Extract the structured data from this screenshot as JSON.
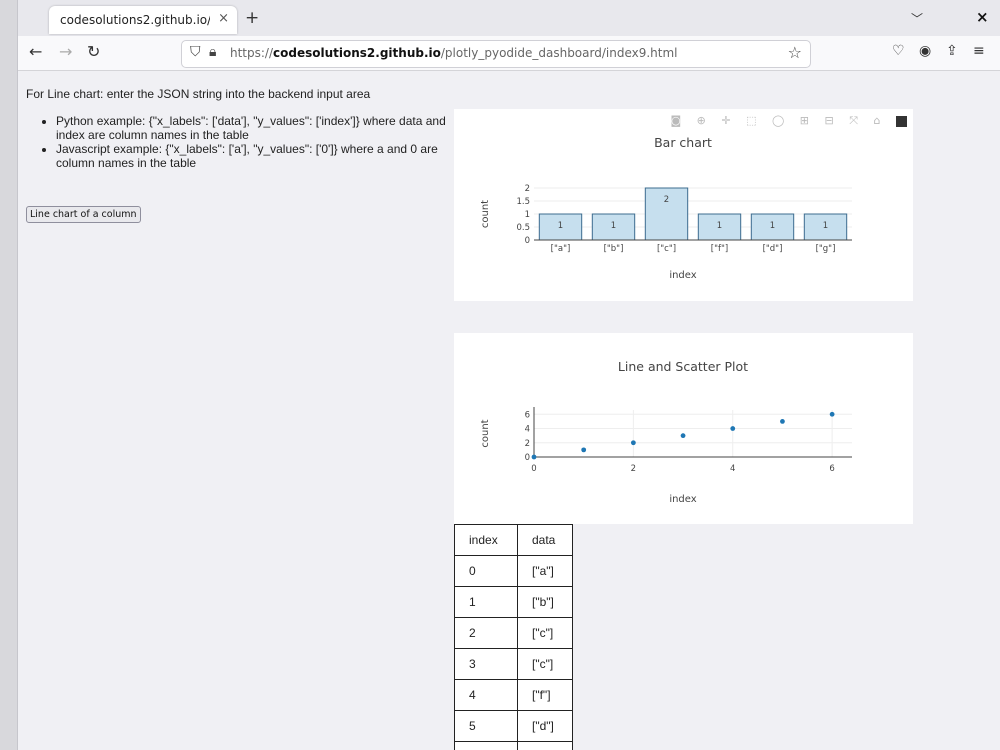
{
  "browser": {
    "tab_title": "codesolutions2.github.io/plo",
    "url_prefix": "https://",
    "url_domain": "codesolutions2.github.io",
    "url_path": "/plotly_pyodide_dashboard/index9.html"
  },
  "page": {
    "intro": "For Line chart: enter the JSON string into the backend input area",
    "bullets": [
      "Python example: {\"x_labels\": ['data'], \"y_values\": ['index']} where data and index are column names in the table",
      "Javascript example: {\"x_labels\": ['a'], \"y_values\": ['0']} where a and 0 are column names in the table"
    ],
    "line_button": "Line chart of a column"
  },
  "chart_data": [
    {
      "type": "bar",
      "title": "Bar chart",
      "xlabel": "index",
      "ylabel": "count",
      "categories": [
        "[\"a\"]",
        "[\"b\"]",
        "[\"c\"]",
        "[\"f\"]",
        "[\"d\"]",
        "[\"g\"]"
      ],
      "values": [
        1,
        1,
        2,
        1,
        1,
        1
      ],
      "ylim": [
        0,
        2
      ],
      "yticks": [
        "0",
        "0.5",
        "1",
        "1.5",
        "2"
      ],
      "bar_color": "#c6dfee",
      "bar_edge": "#3d6c8f"
    },
    {
      "type": "scatter",
      "title": "Line and Scatter Plot",
      "xlabel": "index",
      "ylabel": "count",
      "x": [
        0,
        1,
        2,
        3,
        4,
        5,
        6
      ],
      "y": [
        0,
        1,
        2,
        3,
        4,
        5,
        6
      ],
      "xlim": [
        0,
        6.4
      ],
      "ylim": [
        0,
        6.6
      ],
      "xticks": [
        0,
        2,
        4,
        6
      ],
      "yticks": [
        0,
        2,
        4,
        6
      ],
      "marker_color": "#1f77b4"
    }
  ],
  "table": {
    "headers": [
      "index",
      "data"
    ],
    "rows": [
      [
        "0",
        "[\"a\"]"
      ],
      [
        "1",
        "[\"b\"]"
      ],
      [
        "2",
        "[\"c\"]"
      ],
      [
        "3",
        "[\"c\"]"
      ],
      [
        "4",
        "[\"f\"]"
      ],
      [
        "5",
        "[\"d\"]"
      ],
      [
        "",
        ""
      ]
    ]
  }
}
